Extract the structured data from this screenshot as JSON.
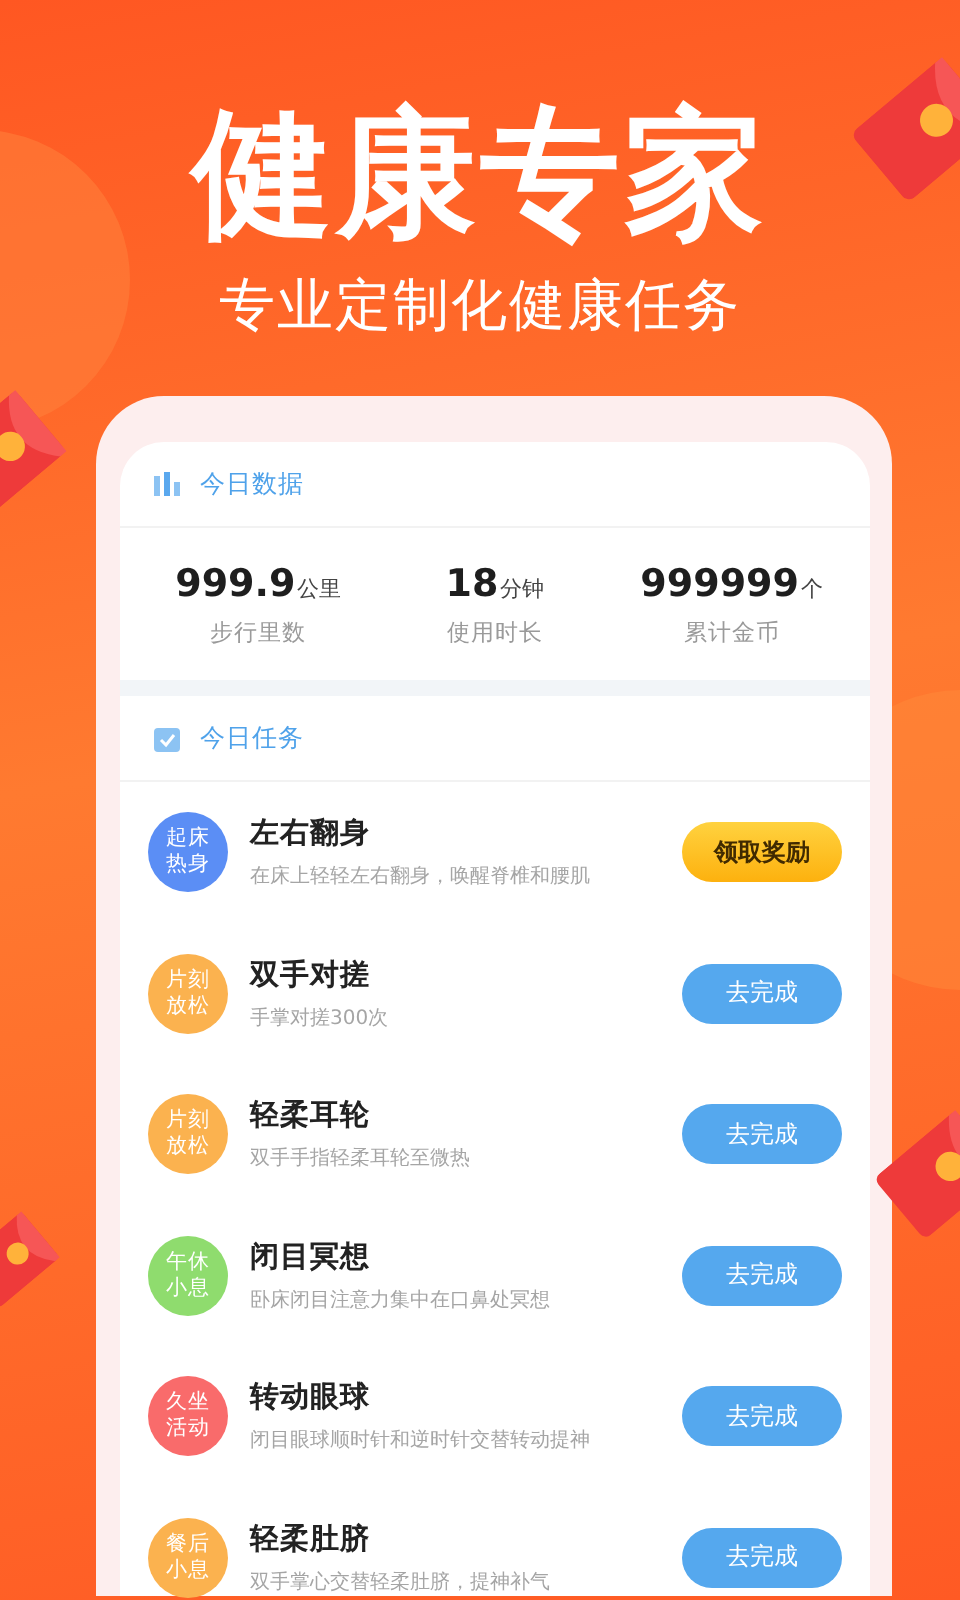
{
  "hero": {
    "title": "健康专家",
    "subtitle": "专业定制化健康任务"
  },
  "today_data": {
    "heading": "今日数据",
    "stats": [
      {
        "value": "999.9",
        "unit": "公里",
        "label": "步行里数"
      },
      {
        "value": "18",
        "unit": "分钟",
        "label": "使用时长"
      },
      {
        "value": "999999",
        "unit": "个",
        "label": "累计金币"
      }
    ]
  },
  "today_tasks": {
    "heading": "今日任务",
    "tasks": [
      {
        "badge": "起床热身",
        "color": "#5b8ef5",
        "title": "左右翻身",
        "desc": "在床上轻轻左右翻身，唤醒脊椎和腰肌",
        "button": {
          "kind": "claim",
          "label": "领取奖励"
        }
      },
      {
        "badge": "片刻放松",
        "color": "#fbb24f",
        "title": "双手对搓",
        "desc": "手掌对搓300次",
        "button": {
          "kind": "go",
          "label": "去完成"
        }
      },
      {
        "badge": "片刻放松",
        "color": "#fbb24f",
        "title": "轻柔耳轮",
        "desc": "双手手指轻柔耳轮至微热",
        "button": {
          "kind": "go",
          "label": "去完成"
        }
      },
      {
        "badge": "午休小息",
        "color": "#8fdc6e",
        "title": "闭目冥想",
        "desc": "卧床闭目注意力集中在口鼻处冥想",
        "button": {
          "kind": "go",
          "label": "去完成"
        }
      },
      {
        "badge": "久坐活动",
        "color": "#f96b6b",
        "title": "转动眼球",
        "desc": "闭目眼球顺时针和逆时针交替转动提神",
        "button": {
          "kind": "go",
          "label": "去完成"
        }
      },
      {
        "badge": "餐后小息",
        "color": "#fbb24f",
        "title": "轻柔肚脐",
        "desc": "双手掌心交替轻柔肚脐，提神补气",
        "button": {
          "kind": "go",
          "label": "去完成"
        }
      }
    ]
  }
}
